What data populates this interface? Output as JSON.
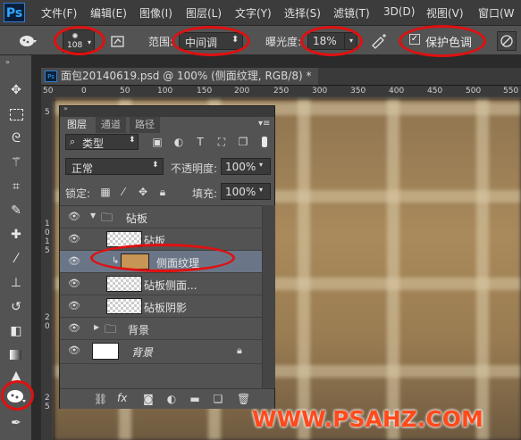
{
  "app": {
    "logo": "Ps"
  },
  "menu": [
    "文件(F)",
    "编辑(E)",
    "图像(I)",
    "图层(L)",
    "文字(Y)",
    "选择(S)",
    "滤镜(T)",
    "3D(D)",
    "视图(V)",
    "窗口(W"
  ],
  "options": {
    "brush_size": "108",
    "range_label": "范围:",
    "range_value": "中间调",
    "exposure_label": "曝光度:",
    "exposure_value": "18%",
    "protect_tones_label": "保护色调",
    "protect_tones_checked": true
  },
  "document": {
    "tab_title": "面包20140619.psd @ 100% (侧面纹理, RGB/8) *",
    "ruler_top": [
      "50",
      "0",
      "50",
      "100",
      "150",
      "200",
      "250",
      "300",
      "350",
      "400",
      "450",
      "500",
      "550"
    ],
    "ruler_left": [
      "5",
      "1",
      "0",
      "1",
      "5",
      "2",
      "0",
      "2",
      "5"
    ]
  },
  "layers_panel": {
    "tabs": [
      "图层",
      "通道",
      "路径"
    ],
    "filter_kind": "类型",
    "blend_mode": "正常",
    "opacity_label": "不透明度:",
    "opacity_value": "100%",
    "lock_label": "锁定:",
    "fill_label": "填充:",
    "fill_value": "100%",
    "layers": [
      {
        "name": "砧板",
        "type": "group"
      },
      {
        "name": "砧板",
        "type": "layer"
      },
      {
        "name": "侧面纹理",
        "type": "layer",
        "selected": true
      },
      {
        "name": "砧板侧面...",
        "type": "layer"
      },
      {
        "name": "砧板阴影",
        "type": "layer"
      },
      {
        "name": "背景",
        "type": "group"
      },
      {
        "name": "背景",
        "type": "background"
      }
    ],
    "footer_fx": "fx"
  },
  "watermark": "WWW.PSAHZ.COM",
  "colors": {
    "highlight_ring": "#e01010",
    "watermark": "#ff4a1c",
    "selected_row": "#6a7687"
  }
}
